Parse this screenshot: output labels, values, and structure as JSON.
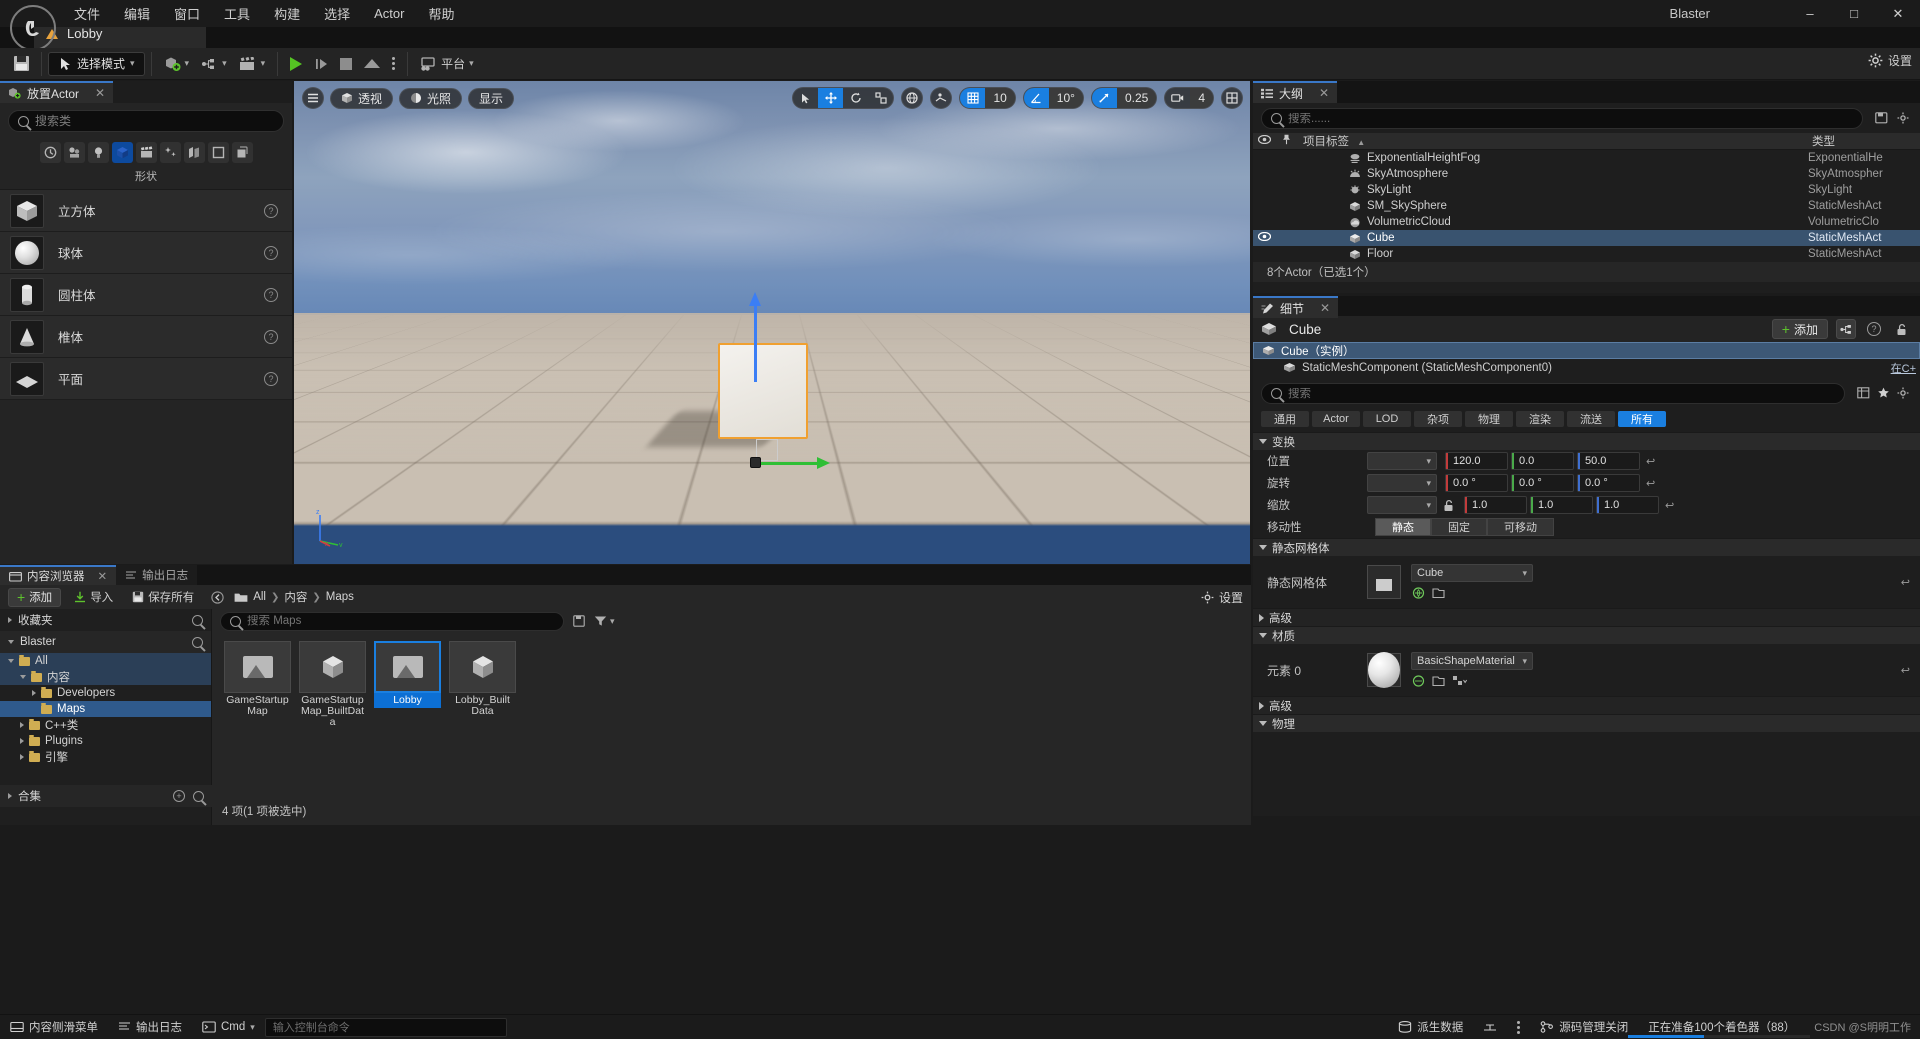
{
  "window": {
    "project_title": "Blaster",
    "minimize": "–",
    "maximize": "□",
    "close": "✕"
  },
  "menu": {
    "items": [
      {
        "label": "文件"
      },
      {
        "label": "编辑"
      },
      {
        "label": "窗口"
      },
      {
        "label": "工具"
      },
      {
        "label": "构建"
      },
      {
        "label": "选择"
      },
      {
        "label": "Actor"
      },
      {
        "label": "帮助"
      }
    ]
  },
  "level_tab": {
    "label": "Lobby"
  },
  "toolbar": {
    "save_label": "",
    "mode_label": "选择模式",
    "platform_label": "平台",
    "settings_label": "设置"
  },
  "place_actors": {
    "tab_label": "放置Actor",
    "close": "✕",
    "search_placeholder": "搜索类",
    "search_value": "",
    "category_label": "形状",
    "categories": [
      {
        "name": "recently-placed-icon"
      },
      {
        "name": "basic-icon"
      },
      {
        "name": "lights-icon"
      },
      {
        "name": "shapes-icon",
        "active": true
      },
      {
        "name": "cinematic-icon"
      },
      {
        "name": "visual-effects-icon"
      },
      {
        "name": "geometry-icon"
      },
      {
        "name": "volumes-icon"
      },
      {
        "name": "all-classes-icon"
      }
    ],
    "shapes": [
      {
        "label": "立方体"
      },
      {
        "label": "球体"
      },
      {
        "label": "圆柱体"
      },
      {
        "label": "椎体"
      },
      {
        "label": "平面"
      }
    ]
  },
  "viewport": {
    "menu_icon": "hamburger-icon",
    "view_mode": "透视",
    "lighting_mode": "光照",
    "show_menu": "显示",
    "grid_snap_value": "10",
    "angle_snap_value": "10°",
    "scale_snap_value": "0.25",
    "camera_speed_value": "4",
    "axis_labels": {
      "x": "x",
      "y": "y",
      "z": "z"
    }
  },
  "outliner": {
    "tab_label": "大纲",
    "close": "✕",
    "search_placeholder": "搜索......",
    "search_value": "",
    "columns": {
      "name": "项目标签",
      "sort_arrow": "▲",
      "type": "类型"
    },
    "rows": [
      {
        "name": "ExponentialHeightFog",
        "type": "ExponentialHe",
        "selected": false,
        "visible": false
      },
      {
        "name": "SkyAtmosphere",
        "type": "SkyAtmospher",
        "selected": false,
        "visible": false
      },
      {
        "name": "SkyLight",
        "type": "SkyLight",
        "selected": false,
        "visible": false
      },
      {
        "name": "SM_SkySphere",
        "type": "StaticMeshAct",
        "selected": false,
        "visible": false
      },
      {
        "name": "VolumetricCloud",
        "type": "VolumetricClo",
        "selected": false,
        "visible": false
      },
      {
        "name": "Cube",
        "type": "StaticMeshAct",
        "selected": true,
        "visible": true
      },
      {
        "name": "Floor",
        "type": "StaticMeshAct",
        "selected": false,
        "visible": false
      }
    ],
    "footer": "8个Actor（已选1个）"
  },
  "details": {
    "tab_label": "细节",
    "close": "✕",
    "object_name": "Cube",
    "add_button": "添加",
    "components": [
      {
        "label": "Cube（实例）",
        "selected": true,
        "link": ""
      },
      {
        "label": "StaticMeshComponent (StaticMeshComponent0)",
        "selected": false,
        "link": "在C+"
      }
    ],
    "search_placeholder": "搜索",
    "search_value": "",
    "filters": [
      {
        "label": "通用",
        "active": false
      },
      {
        "label": "Actor",
        "active": false
      },
      {
        "label": "LOD",
        "active": false
      },
      {
        "label": "杂项",
        "active": false
      },
      {
        "label": "物理",
        "active": false
      },
      {
        "label": "渲染",
        "active": false
      },
      {
        "label": "流送",
        "active": false
      },
      {
        "label": "所有",
        "active": true
      }
    ],
    "sections": {
      "transform": {
        "title": "变换",
        "location": {
          "label": "位置",
          "mode": "",
          "x": "120.0",
          "y": "0.0",
          "z": "50.0"
        },
        "rotation": {
          "label": "旋转",
          "mode": "",
          "x": "0.0 °",
          "y": "0.0 °",
          "z": "0.0 °"
        },
        "scale": {
          "label": "缩放",
          "mode": "",
          "x": "1.0",
          "y": "1.0",
          "z": "1.0"
        },
        "mobility": {
          "label": "移动性",
          "options": [
            {
              "label": "静态",
              "active": true
            },
            {
              "label": "固定",
              "active": false
            },
            {
              "label": "可移动",
              "active": false
            }
          ]
        }
      },
      "static_mesh": {
        "title": "静态网格体",
        "prop_label": "静态网格体",
        "value": "Cube",
        "advanced": "高级"
      },
      "materials": {
        "title": "材质",
        "element_label": "元素 0",
        "value": "BasicShapeMaterial",
        "advanced": "高级"
      },
      "physics": {
        "title": "物理"
      }
    }
  },
  "content_browser": {
    "tabs": [
      {
        "label": "内容浏览器",
        "active": true,
        "close": "✕"
      },
      {
        "label": "输出日志",
        "active": false
      }
    ],
    "toolbar": {
      "add": "添加",
      "import": "导入",
      "save_all": "保存所有",
      "settings": "设置"
    },
    "breadcrumb": [
      {
        "label": "All"
      },
      {
        "label": "内容"
      },
      {
        "label": "Maps"
      }
    ],
    "sidebar": {
      "favorites": "收藏夹",
      "project": "Blaster",
      "tree": [
        {
          "label": "All",
          "depth": 0,
          "expanded": true,
          "highlight": false
        },
        {
          "label": "内容",
          "depth": 1,
          "expanded": true,
          "highlight": true
        },
        {
          "label": "Developers",
          "depth": 2,
          "expanded": false,
          "highlight": false
        },
        {
          "label": "Maps",
          "depth": 2,
          "expanded": false,
          "highlight": false,
          "selected": true
        },
        {
          "label": "C++类",
          "depth": 1,
          "expanded": false,
          "highlight": false
        },
        {
          "label": "Plugins",
          "depth": 1,
          "expanded": false,
          "highlight": false
        },
        {
          "label": "引擎",
          "depth": 1,
          "expanded": false,
          "highlight": false
        }
      ],
      "collections": "合集"
    },
    "search_placeholder": "搜索 Maps",
    "search_value": "",
    "assets": [
      {
        "label": "GameStartup Map",
        "type": "map",
        "selected": false
      },
      {
        "label": "GameStartup Map_BuiltData",
        "type": "data",
        "selected": false
      },
      {
        "label": "Lobby",
        "type": "map",
        "selected": true
      },
      {
        "label": "Lobby_Built Data",
        "type": "data",
        "selected": false
      }
    ],
    "status": "4 项(1 项被选中)"
  },
  "statusbar": {
    "items": [
      {
        "label": "内容侧滑菜单",
        "icon": "drawer-icon"
      },
      {
        "label": "输出日志",
        "icon": "log-icon"
      },
      {
        "label": "Cmd",
        "icon": "cmd-icon"
      }
    ],
    "cmd_placeholder": "输入控制台命令",
    "cmd_value": "",
    "right_items": [
      {
        "label": "派生数据",
        "icon": "derived-data-icon"
      },
      {
        "label": "源码管理关闭",
        "icon": "source-control-icon"
      }
    ],
    "progress_text": "正在准备100个着色器（88）",
    "watermark": "CSDN @S明明工作"
  }
}
